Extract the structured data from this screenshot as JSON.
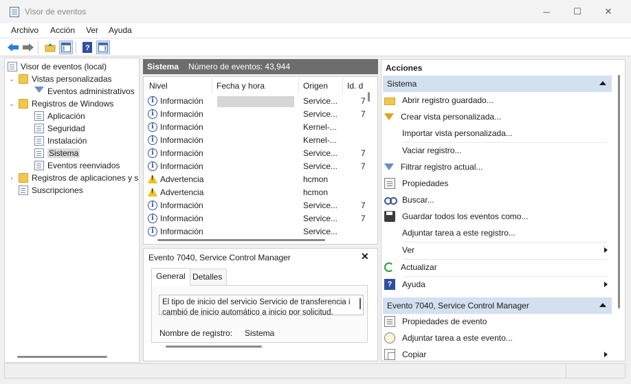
{
  "window": {
    "title": "Visor de eventos",
    "minimize": "─",
    "maximize": "☐",
    "close": "✕"
  },
  "menu": [
    "Archivo",
    "Acción",
    "Ver",
    "Ayuda"
  ],
  "tree": {
    "root": "Visor de eventos (local)",
    "custom_views": "Vistas personalizadas",
    "admin_events": "Eventos administrativos",
    "windows_logs": "Registros de Windows",
    "app": "Aplicación",
    "security": "Seguridad",
    "setup": "Instalación",
    "system": "Sistema",
    "forwarded": "Eventos reenviados",
    "apps_services": "Registros de aplicaciones y s",
    "subscriptions": "Suscripciones"
  },
  "center": {
    "log_name": "Sistema",
    "event_count": "Número de eventos: 43,944",
    "columns": [
      "Nivel",
      "Fecha y hora",
      "Origen",
      "Id. d"
    ],
    "rows": [
      {
        "level": "Información",
        "type": "info",
        "source": "Service...",
        "id": "7"
      },
      {
        "level": "Información",
        "type": "info",
        "source": "Service...",
        "id": "7"
      },
      {
        "level": "Información",
        "type": "info",
        "source": "Kernel-...",
        "id": ""
      },
      {
        "level": "Información",
        "type": "info",
        "source": "Kernel-...",
        "id": ""
      },
      {
        "level": "Información",
        "type": "info",
        "source": "Service...",
        "id": "7"
      },
      {
        "level": "Información",
        "type": "info",
        "source": "Service...",
        "id": "7"
      },
      {
        "level": "Advertencia",
        "type": "warn",
        "source": "hcmon",
        "id": ""
      },
      {
        "level": "Advertencia",
        "type": "warn",
        "source": "hcmon",
        "id": ""
      },
      {
        "level": "Información",
        "type": "info",
        "source": "Service...",
        "id": "7"
      },
      {
        "level": "Información",
        "type": "info",
        "source": "Service...",
        "id": "7"
      },
      {
        "level": "Información",
        "type": "info",
        "source": "Service...",
        "id": ""
      }
    ]
  },
  "detail": {
    "title": "Evento 7040, Service Control Manager",
    "close": "✕",
    "tab_general": "General",
    "tab_details": "Detalles",
    "description_line1": "El tipo de inicio del servicio Servicio de transferencia i",
    "description_line2": "cambió de inicio automático a inicio por solicitud.",
    "log_name_label": "Nombre de registro:",
    "log_name_value": "Sistema"
  },
  "actions": {
    "title": "Acciones",
    "section1": "Sistema",
    "items1": [
      "Abrir registro guardado...",
      "Crear vista personalizada...",
      "Importar vista personalizada...",
      "Vaciar registro...",
      "Filtrar registro actual...",
      "Propiedades",
      "Buscar...",
      "Guardar todos los eventos como...",
      "Adjuntar tarea a este registro...",
      "Ver",
      "Actualizar",
      "Ayuda"
    ],
    "section2": "Evento 7040, Service Control Manager",
    "items2": [
      "Propiedades de evento",
      "Adjuntar tarea a este evento...",
      "Copiar"
    ]
  }
}
